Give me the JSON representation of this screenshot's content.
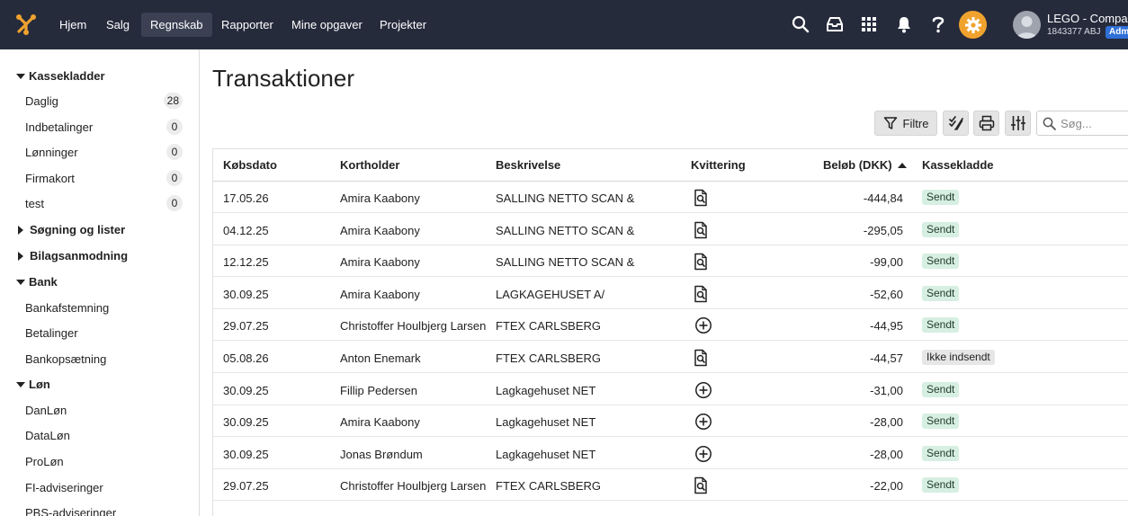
{
  "topnav": {
    "items": [
      "Hjem",
      "Salg",
      "Regnskab",
      "Rapporter",
      "Mine opgaver",
      "Projekter"
    ],
    "active": "Regnskab"
  },
  "account": {
    "company": "LEGO - Compan",
    "id": "1843377 ABJ",
    "role": "Adm"
  },
  "colors": {
    "topbar": "#262b3c",
    "gear_accent": "#f0a22e",
    "badge_sent_bg": "#d6efe2",
    "role_badge": "#2f6fd8"
  },
  "sidebar": {
    "kassekladder": {
      "label": "Kassekladder",
      "items": [
        {
          "label": "Daglig",
          "count": "28"
        },
        {
          "label": "Indbetalinger",
          "count": "0"
        },
        {
          "label": "Lønninger",
          "count": "0"
        },
        {
          "label": "Firmakort",
          "count": "0"
        },
        {
          "label": "test",
          "count": "0"
        }
      ]
    },
    "soegning": {
      "label": "Søgning og lister"
    },
    "bilagsanmodning": {
      "label": "Bilagsanmodning"
    },
    "bank": {
      "label": "Bank",
      "items": [
        {
          "label": "Bankafstemning"
        },
        {
          "label": "Betalinger"
        },
        {
          "label": "Bankopsætning"
        }
      ]
    },
    "loen": {
      "label": "Løn",
      "items": [
        {
          "label": "DanLøn"
        },
        {
          "label": "DataLøn"
        },
        {
          "label": "ProLøn"
        },
        {
          "label": "FI-adviseringer"
        },
        {
          "label": "PBS-adviseringer"
        }
      ]
    }
  },
  "main": {
    "title": "Transaktioner",
    "filter_label": "Filtre",
    "search_placeholder": "Søg..."
  },
  "table": {
    "headers": {
      "date": "Købsdato",
      "holder": "Kortholder",
      "description": "Beskrivelse",
      "receipt": "Kvittering",
      "amount": "Beløb (DKK)",
      "journal": "Kassekladde"
    },
    "sort": {
      "column": "amount",
      "direction": "ascending"
    },
    "rows": [
      {
        "date": "17.05.26",
        "holder": "Amira Kaabony",
        "description": "SALLING NETTO SCAN &",
        "receipt": "document-search-icon",
        "amount": "-444,84",
        "status": "Sendt"
      },
      {
        "date": "04.12.25",
        "holder": "Amira Kaabony",
        "description": "SALLING NETTO SCAN &",
        "receipt": "document-search-icon",
        "amount": "-295,05",
        "status": "Sendt"
      },
      {
        "date": "12.12.25",
        "holder": "Amira Kaabony",
        "description": "SALLING NETTO SCAN &",
        "receipt": "document-search-icon",
        "amount": "-99,00",
        "status": "Sendt"
      },
      {
        "date": "30.09.25",
        "holder": "Amira Kaabony",
        "description": "LAGKAGEHUSET A/",
        "receipt": "document-search-icon",
        "amount": "-52,60",
        "status": "Sendt"
      },
      {
        "date": "29.07.25",
        "holder": "Christoffer Houlbjerg Larsen",
        "description": "FTEX CARLSBERG",
        "receipt": "add-circle-icon",
        "amount": "-44,95",
        "status": "Sendt"
      },
      {
        "date": "05.08.26",
        "holder": "Anton Enemark",
        "description": "FTEX CARLSBERG",
        "receipt": "document-search-icon",
        "amount": "-44,57",
        "status": "Ikke indsendt"
      },
      {
        "date": "30.09.25",
        "holder": "Fillip Pedersen",
        "description": "Lagkagehuset NET",
        "receipt": "add-circle-icon",
        "amount": "-31,00",
        "status": "Sendt"
      },
      {
        "date": "30.09.25",
        "holder": "Amira Kaabony",
        "description": "Lagkagehuset NET",
        "receipt": "add-circle-icon",
        "amount": "-28,00",
        "status": "Sendt"
      },
      {
        "date": "30.09.25",
        "holder": "Jonas Brøndum",
        "description": "Lagkagehuset NET",
        "receipt": "add-circle-icon",
        "amount": "-28,00",
        "status": "Sendt"
      },
      {
        "date": "29.07.25",
        "holder": "Christoffer Houlbjerg Larsen",
        "description": "FTEX CARLSBERG",
        "receipt": "document-search-icon",
        "amount": "-22,00",
        "status": "Sendt"
      }
    ]
  }
}
